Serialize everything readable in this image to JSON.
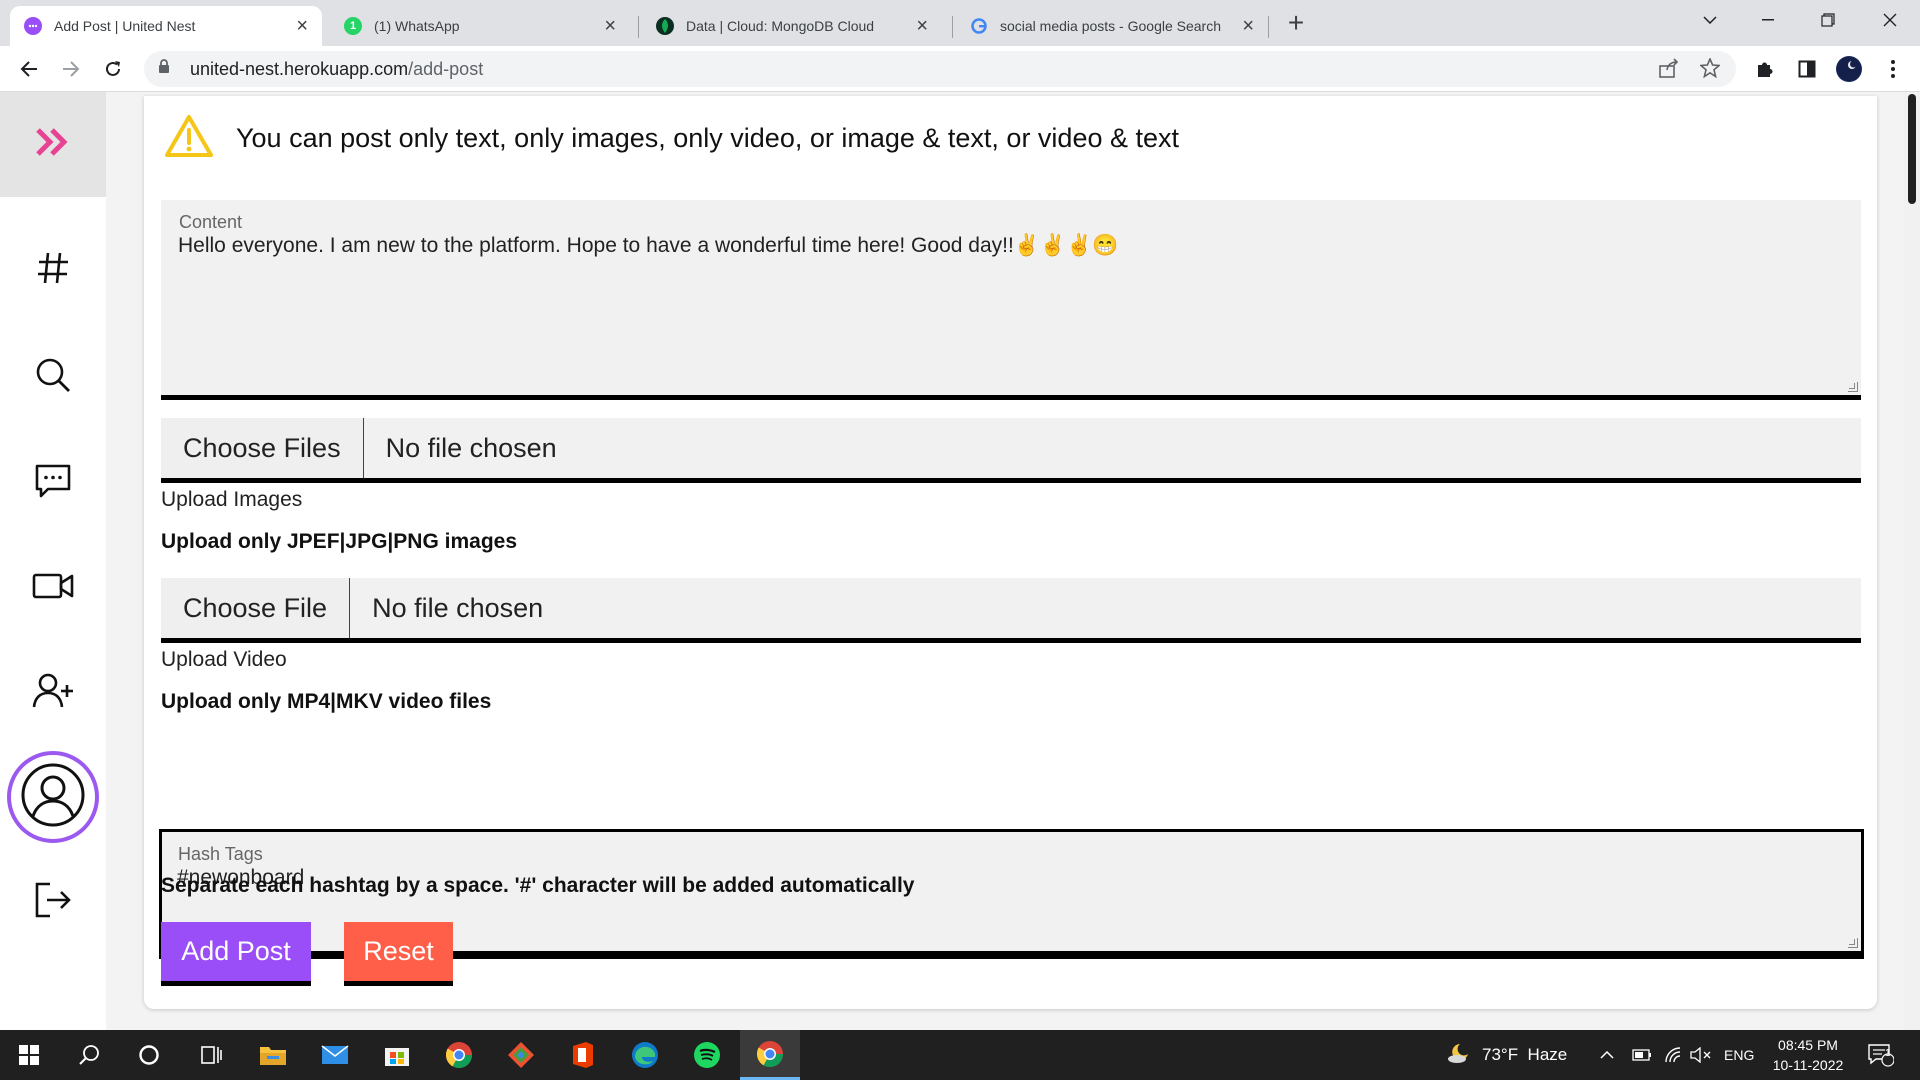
{
  "browser": {
    "tabs": [
      {
        "title": "Add Post | United Nest",
        "active": true,
        "favicon_color": "#9a4ef8"
      },
      {
        "title": "(1) WhatsApp",
        "active": false,
        "favicon_color": "#25d366",
        "favicon_text": "1"
      },
      {
        "title": "Data | Cloud: MongoDB Cloud",
        "active": false,
        "favicon_color": "#0b2e20"
      },
      {
        "title": "social media posts - Google Search",
        "active": false,
        "favicon_color": "#ffffff"
      }
    ],
    "url_host": "united-nest.herokuapp.com",
    "url_path": "/add-post"
  },
  "page": {
    "warning": "You can post only text, only images, only video, or image & text, or video & text",
    "content_label": "Content",
    "content_value": "Hello everyone. I am new to the platform. Hope to have a wonderful time here! Good day!!✌✌✌😁",
    "images_button": "Choose Files",
    "images_status": "No file chosen",
    "images_label": "Upload Images",
    "images_hint": "Upload only JPEF|JPG|PNG images",
    "video_button": "Choose File",
    "video_status": "No file chosen",
    "video_label": "Upload Video",
    "video_hint": "Upload only MP4|MKV video files",
    "hashtags_label": "Hash Tags",
    "hashtags_value": "#newonboard",
    "hashtags_hint": "Separate each hashtag by a space. '#' character will be added automatically",
    "add_button": "Add Post",
    "reset_button": "Reset"
  },
  "colors": {
    "accent": "#9a4ef8",
    "reset": "#ff5e48",
    "sidebar_toggle": "#e84393"
  },
  "sidebar": {
    "icons": [
      "chevrons-right-icon",
      "hashtag-icon",
      "search-icon",
      "chat-icon",
      "video-icon",
      "add-user-icon",
      "profile-avatar-icon",
      "logout-icon"
    ]
  },
  "taskbar": {
    "weather": "73°F  Haze",
    "lang": "ENG",
    "time": "08:45 PM",
    "date": "10-11-2022",
    "notification_count": "1"
  }
}
